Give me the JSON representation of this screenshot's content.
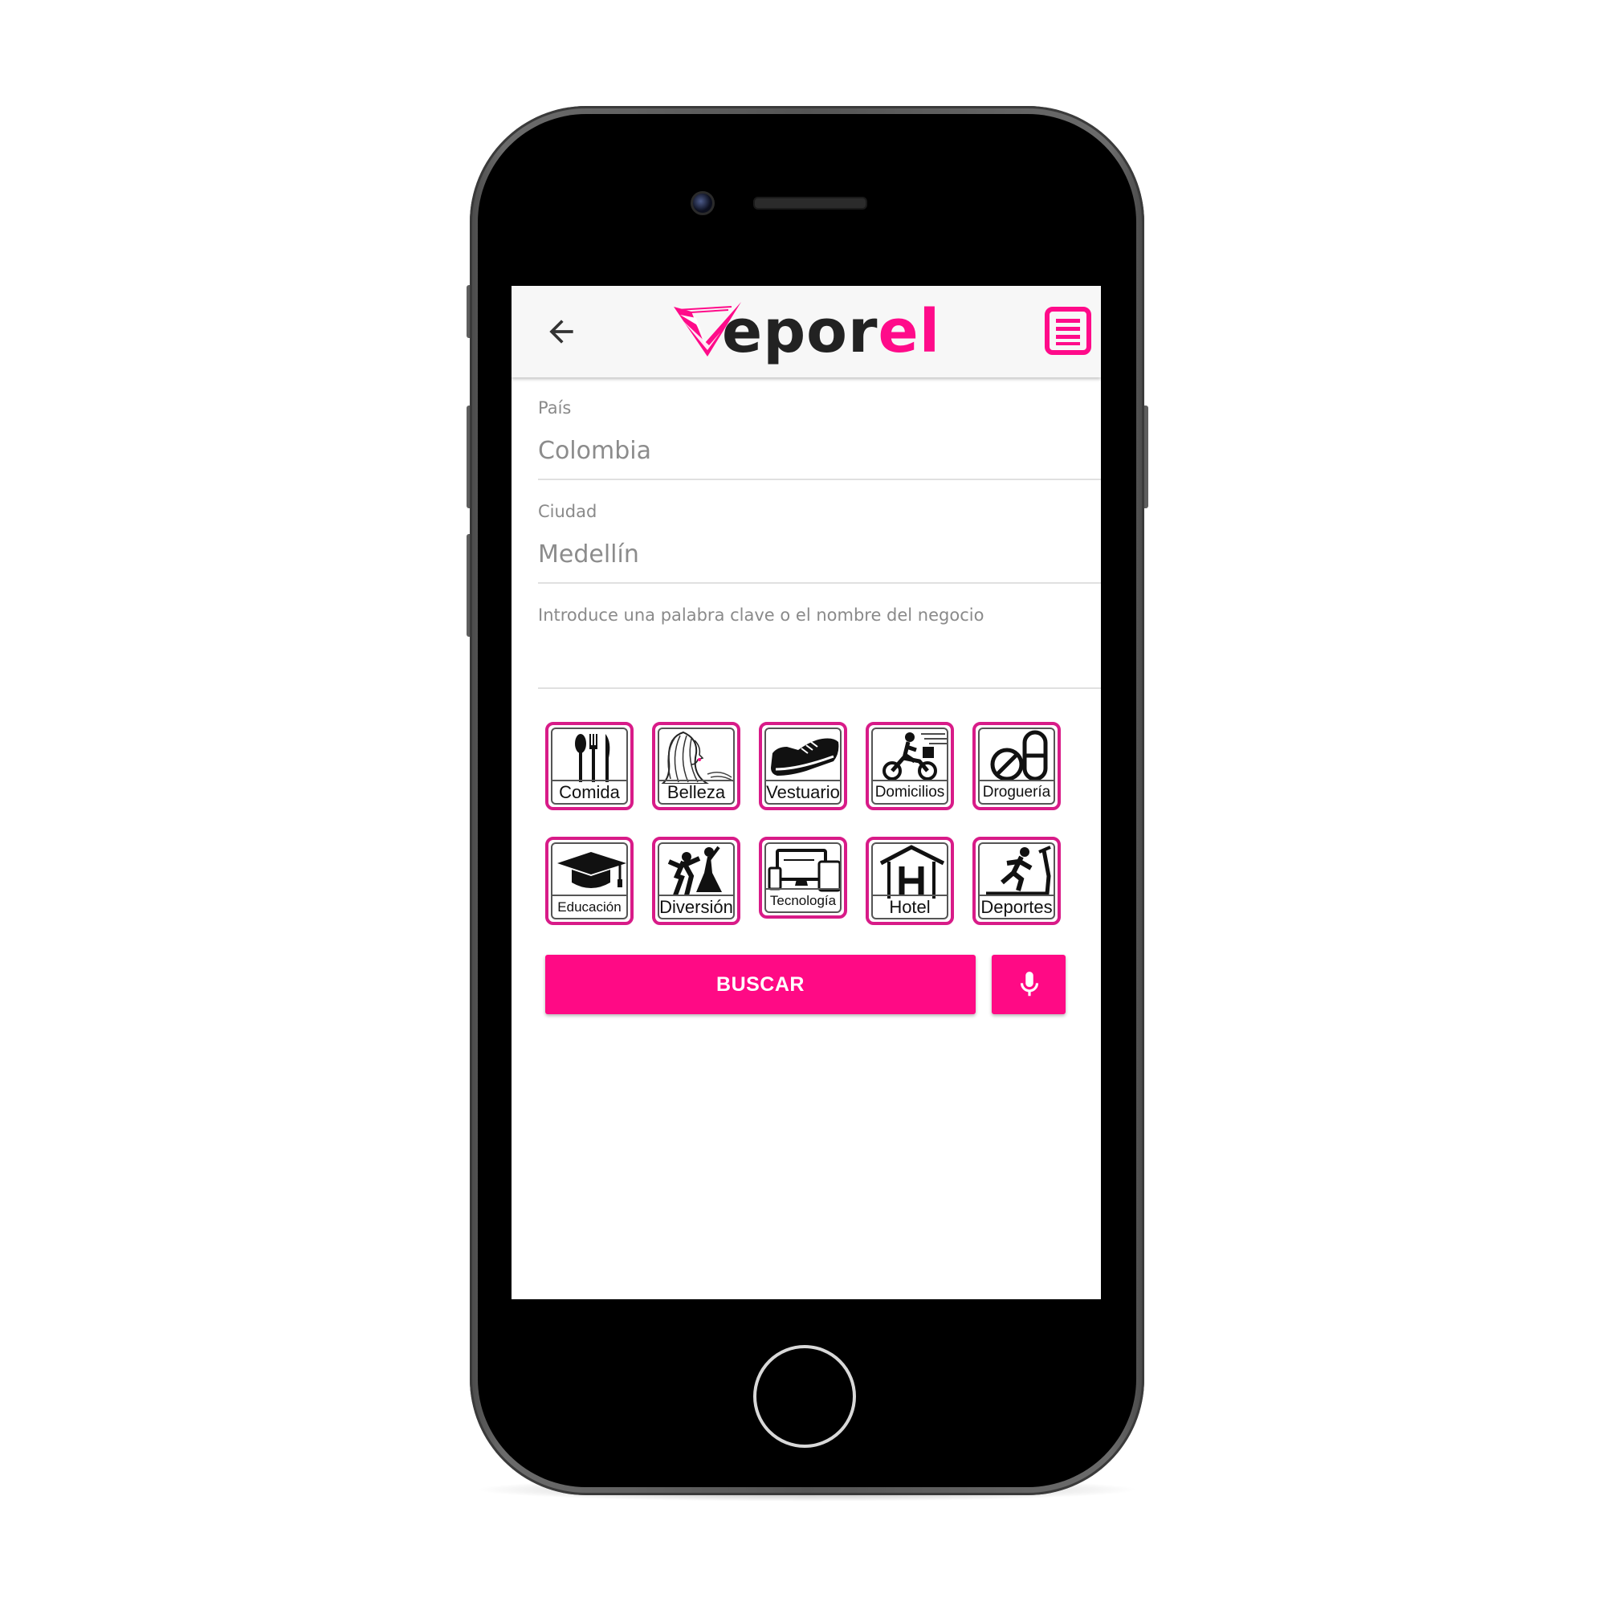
{
  "app": {
    "logo_text_dark": "ep",
    "logo_text_dark2": "or",
    "logo_text_pink": "e",
    "logo_text_pink2": "l",
    "brand_color": "#ff0a85",
    "back_icon": "arrow-left-icon",
    "menu_icon": "list-menu-icon"
  },
  "form": {
    "country": {
      "label": "País",
      "value": "Colombia"
    },
    "city": {
      "label": "Ciudad",
      "value": "Medellín"
    },
    "keyword": {
      "placeholder": "Introduce una palabra clave o el nombre del negocio",
      "value": ""
    }
  },
  "categories": [
    {
      "label": "Comida",
      "icon": "cutlery-icon"
    },
    {
      "label": "Belleza",
      "icon": "woman-hair-icon"
    },
    {
      "label": "Vestuario",
      "icon": "shoe-icon"
    },
    {
      "label": "Domicilios",
      "icon": "delivery-motorbike-icon"
    },
    {
      "label": "Droguería",
      "icon": "pills-icon"
    },
    {
      "label": "Educación",
      "icon": "graduation-cap-icon"
    },
    {
      "label": "Diversión",
      "icon": "dancing-couple-icon"
    },
    {
      "label": "Tecnología",
      "icon": "devices-icon"
    },
    {
      "label": "Hotel",
      "icon": "hotel-icon"
    },
    {
      "label": "Deportes",
      "icon": "treadmill-runner-icon"
    }
  ],
  "actions": {
    "search_label": "BUSCAR",
    "mic_icon": "microphone-icon"
  }
}
